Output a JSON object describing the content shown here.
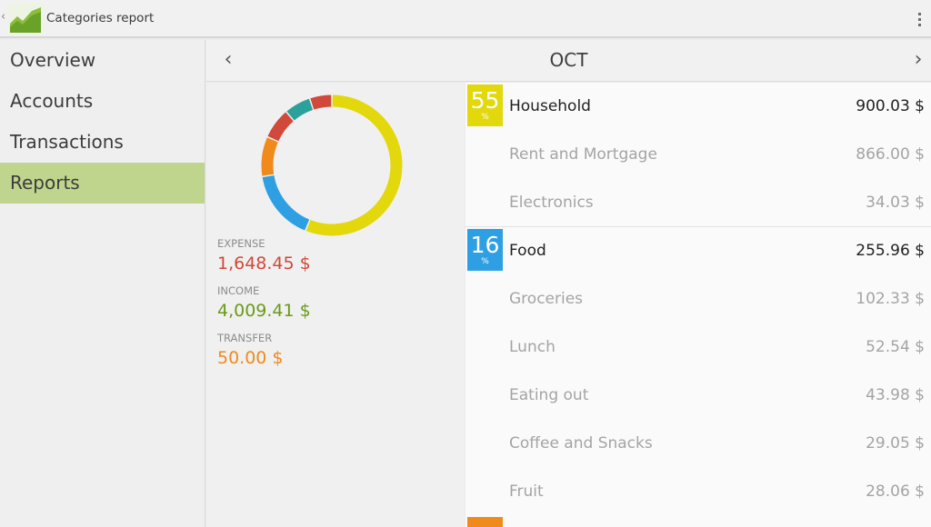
{
  "header": {
    "title": "Categories report",
    "up_caret": "‹"
  },
  "sidebar": {
    "items": [
      {
        "label": "Overview",
        "active": false
      },
      {
        "label": "Accounts",
        "active": false
      },
      {
        "label": "Transactions",
        "active": false
      },
      {
        "label": "Reports",
        "active": true
      }
    ]
  },
  "period": {
    "label": "OCT",
    "prev_icon": "‹",
    "next_icon": "›"
  },
  "summary": {
    "expense_label": "EXPENSE",
    "expense_value": "1,648.45 $",
    "income_label": "INCOME",
    "income_value": "4,009.41 $",
    "transfer_label": "TRANSFER",
    "transfer_value": "50.00 $",
    "colors": {
      "expense": "#d0493a",
      "income": "#6c9a16",
      "transfer": "#f08a1b"
    }
  },
  "chart_data": {
    "type": "pie",
    "segments": [
      {
        "share": 55,
        "color": "#e3d80b"
      },
      {
        "share": 16,
        "color": "#2f9fe3"
      },
      {
        "share": 9,
        "color": "#f08a1b"
      },
      {
        "share": 7,
        "color": "#d0493a"
      },
      {
        "share": 6,
        "color": "#2aa19b"
      },
      {
        "share": 5,
        "color": "#d0493a"
      }
    ]
  },
  "categories": [
    {
      "percent": "55",
      "percent_sign": "%",
      "color": "#e3d80b",
      "name": "Household",
      "amount": "900.03 $",
      "items": [
        {
          "name": "Rent and Mortgage",
          "amount": "866.00 $"
        },
        {
          "name": "Electronics",
          "amount": "34.03 $"
        }
      ]
    },
    {
      "percent": "16",
      "percent_sign": "%",
      "color": "#2f9fe3",
      "name": "Food",
      "amount": "255.96 $",
      "items": [
        {
          "name": "Groceries",
          "amount": "102.33 $"
        },
        {
          "name": "Lunch",
          "amount": "52.54 $"
        },
        {
          "name": "Eating out",
          "amount": "43.98 $"
        },
        {
          "name": "Coffee and Snacks",
          "amount": "29.05 $"
        },
        {
          "name": "Fruit",
          "amount": "28.06 $"
        }
      ]
    }
  ],
  "next_category_color": "#f08a1b"
}
